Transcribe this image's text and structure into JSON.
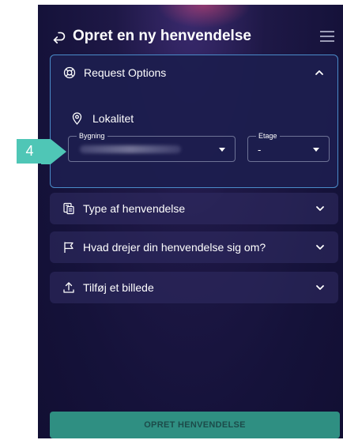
{
  "header": {
    "title": "Opret en ny henvendelse"
  },
  "request_options": {
    "title": "Request Options",
    "lokalitet_label": "Lokalitet",
    "bygning_label": "Bygning",
    "etage_label": "Etage",
    "etage_value": "-"
  },
  "sections": [
    {
      "label": "Type af henvendelse"
    },
    {
      "label": "Hvad drejer din henvendelse sig om?"
    },
    {
      "label": "Tilføj et billede"
    }
  ],
  "submit": {
    "label": "OPRET HENVENDELSE"
  },
  "callout": {
    "number": "4"
  },
  "colors": {
    "accent": "#4fc6b6",
    "submit": "#2f8f82",
    "border": "#4a8bc9"
  }
}
